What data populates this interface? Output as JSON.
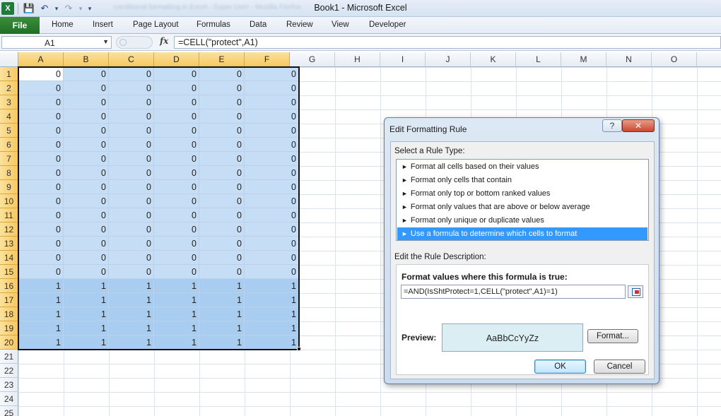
{
  "window": {
    "title": "Book1  -  Microsoft Excel",
    "app_icon": "X",
    "qat_blur": "conditional formatting in Excel - Super User - Mozilla Firefox"
  },
  "qat": {
    "save": "💾",
    "undo": "↶",
    "redo": "↷",
    "more": "▾"
  },
  "ribbon": {
    "file": "File",
    "tabs": [
      "Home",
      "Insert",
      "Page Layout",
      "Formulas",
      "Data",
      "Review",
      "View",
      "Developer"
    ]
  },
  "formula_bar": {
    "name_box": "A1",
    "name_arrow": "▼",
    "fx": "fx",
    "formula": "=CELL(\"protect\",A1)"
  },
  "grid": {
    "columns": [
      "A",
      "B",
      "C",
      "D",
      "E",
      "F",
      "G",
      "H",
      "I",
      "J",
      "K",
      "L",
      "M",
      "N",
      "O"
    ],
    "selected_columns": [
      "A",
      "B",
      "C",
      "D",
      "E",
      "F"
    ],
    "rows": [
      "1",
      "2",
      "3",
      "4",
      "5",
      "6",
      "7",
      "8",
      "9",
      "10",
      "11",
      "12",
      "13",
      "14",
      "15",
      "16",
      "17",
      "18",
      "19",
      "20",
      "21",
      "22",
      "23",
      "24",
      "25"
    ],
    "selected_rows": 20,
    "values": [
      [
        "0",
        "0",
        "0",
        "0",
        "0",
        "0"
      ],
      [
        "0",
        "0",
        "0",
        "0",
        "0",
        "0"
      ],
      [
        "0",
        "0",
        "0",
        "0",
        "0",
        "0"
      ],
      [
        "0",
        "0",
        "0",
        "0",
        "0",
        "0"
      ],
      [
        "0",
        "0",
        "0",
        "0",
        "0",
        "0"
      ],
      [
        "0",
        "0",
        "0",
        "0",
        "0",
        "0"
      ],
      [
        "0",
        "0",
        "0",
        "0",
        "0",
        "0"
      ],
      [
        "0",
        "0",
        "0",
        "0",
        "0",
        "0"
      ],
      [
        "0",
        "0",
        "0",
        "0",
        "0",
        "0"
      ],
      [
        "0",
        "0",
        "0",
        "0",
        "0",
        "0"
      ],
      [
        "0",
        "0",
        "0",
        "0",
        "0",
        "0"
      ],
      [
        "0",
        "0",
        "0",
        "0",
        "0",
        "0"
      ],
      [
        "0",
        "0",
        "0",
        "0",
        "0",
        "0"
      ],
      [
        "0",
        "0",
        "0",
        "0",
        "0",
        "0"
      ],
      [
        "0",
        "0",
        "0",
        "0",
        "0",
        "0"
      ],
      [
        "1",
        "1",
        "1",
        "1",
        "1",
        "1"
      ],
      [
        "1",
        "1",
        "1",
        "1",
        "1",
        "1"
      ],
      [
        "1",
        "1",
        "1",
        "1",
        "1",
        "1"
      ],
      [
        "1",
        "1",
        "1",
        "1",
        "1",
        "1"
      ],
      [
        "1",
        "1",
        "1",
        "1",
        "1",
        "1"
      ]
    ]
  },
  "dialog": {
    "title": "Edit Formatting Rule",
    "help": "?",
    "close": "✕",
    "rule_type_label": "Select a Rule Type:",
    "rule_types": [
      "Format all cells based on their values",
      "Format only cells that contain",
      "Format only top or bottom ranked values",
      "Format only values that are above or below average",
      "Format only unique or duplicate values",
      "Use a formula to determine which cells to format"
    ],
    "selected_rule": 5,
    "rule_bullet": "►",
    "description_label": "Edit the Rule Description:",
    "formula_heading": "Format values where this formula is true:",
    "formula": "=AND(IsShtProtect=1,CELL(\"protect\",A1)=1)",
    "preview_label": "Preview:",
    "preview_text": "AaBbCcYyZz",
    "format_button": "Format...",
    "ok_button": "OK",
    "cancel_button": "Cancel"
  }
}
